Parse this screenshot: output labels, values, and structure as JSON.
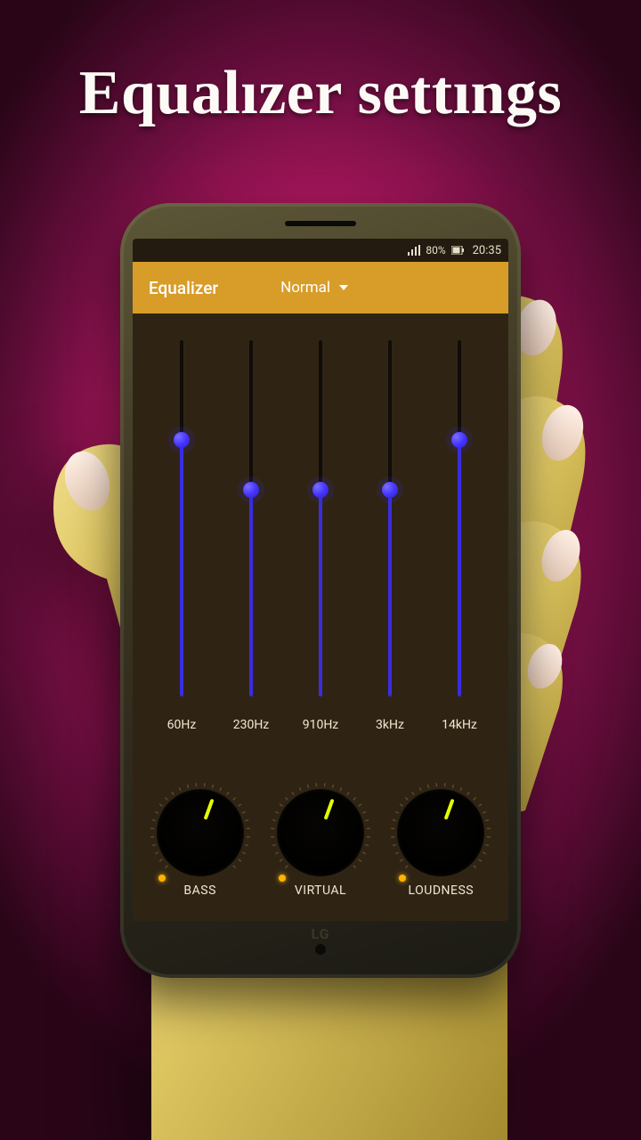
{
  "heading": "Equalızer settıngs",
  "status": {
    "signal_icon": "signal",
    "battery": "80%",
    "battery_icon": "battery",
    "time": "20:35"
  },
  "appbar": {
    "title": "Equalizer",
    "preset": "Normal"
  },
  "sliders": [
    {
      "label": "60Hz",
      "pct": 72
    },
    {
      "label": "230Hz",
      "pct": 58
    },
    {
      "label": "910Hz",
      "pct": 58
    },
    {
      "label": "3kHz",
      "pct": 58
    },
    {
      "label": "14kHz",
      "pct": 72
    }
  ],
  "knobs": [
    {
      "label": "BASS",
      "angle": 200
    },
    {
      "label": "VIRTUAL",
      "angle": 200
    },
    {
      "label": "LOUDNESS",
      "angle": 200
    }
  ],
  "phone_brand": "LG"
}
